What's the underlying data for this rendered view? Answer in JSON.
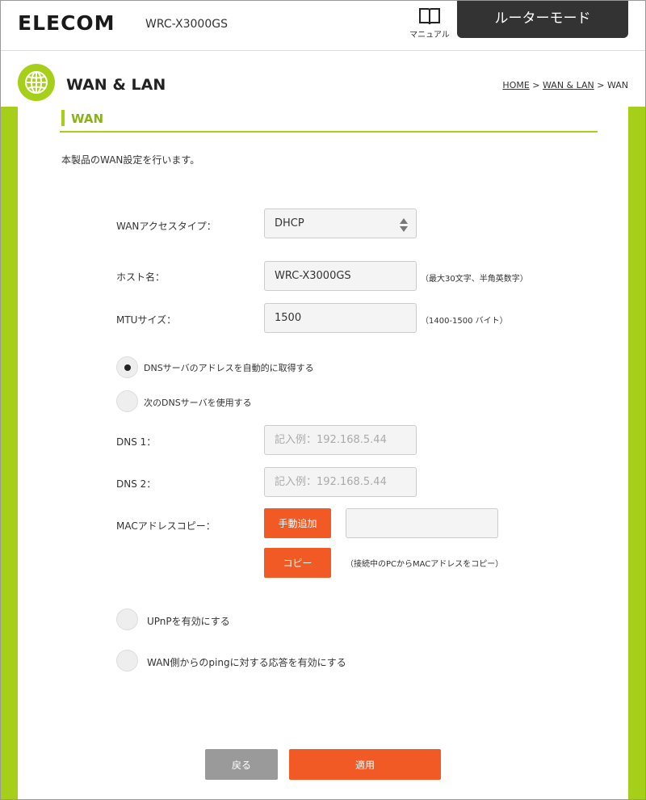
{
  "header": {
    "logo": "ELECOM",
    "model": "WRC-X3000GS",
    "manual_label": "マニュアル",
    "mode": "ルーターモード"
  },
  "title_bar": {
    "title": "WAN & LAN",
    "breadcrumb": {
      "home": "HOME",
      "sep1": " > ",
      "wanlan": "WAN & LAN",
      "sep2": " > ",
      "current": "WAN"
    }
  },
  "section": {
    "title": "WAN",
    "description": "本製品のWAN設定を行います。"
  },
  "form": {
    "access_type": {
      "label": "WANアクセスタイプ：",
      "value": "DHCP"
    },
    "hostname": {
      "label": "ホスト名：",
      "value": "WRC-X3000GS",
      "hint": "（最大30文字、半角英数字）"
    },
    "mtu": {
      "label": "MTUサイズ：",
      "value": "1500",
      "hint": "（1400-1500 バイト）"
    },
    "dns_auto": {
      "label": "DNSサーバのアドレスを自動的に取得する",
      "selected": true
    },
    "dns_manual": {
      "label": "次のDNSサーバを使用する",
      "selected": false
    },
    "dns1": {
      "label": "DNS 1：",
      "placeholder": "記入例：192.168.5.44"
    },
    "dns2": {
      "label": "DNS 2：",
      "placeholder": "記入例：192.168.5.44"
    },
    "mac": {
      "label": "MACアドレスコピー：",
      "manual_button": "手動追加",
      "copy_button": "コピー",
      "copy_hint": "（接続中のPCからMACアドレスをコピー）",
      "value": ""
    },
    "upnp": {
      "label": "UPnPを有効にする"
    },
    "ping": {
      "label": "WAN側からのpingに対する応答を有効にする"
    }
  },
  "footer": {
    "back": "戻る",
    "apply": "適用"
  },
  "colors": {
    "accent_green": "#a6cf1a",
    "button_orange": "#f15a24",
    "button_gray": "#9a9a9a",
    "header_dark": "#333333"
  }
}
